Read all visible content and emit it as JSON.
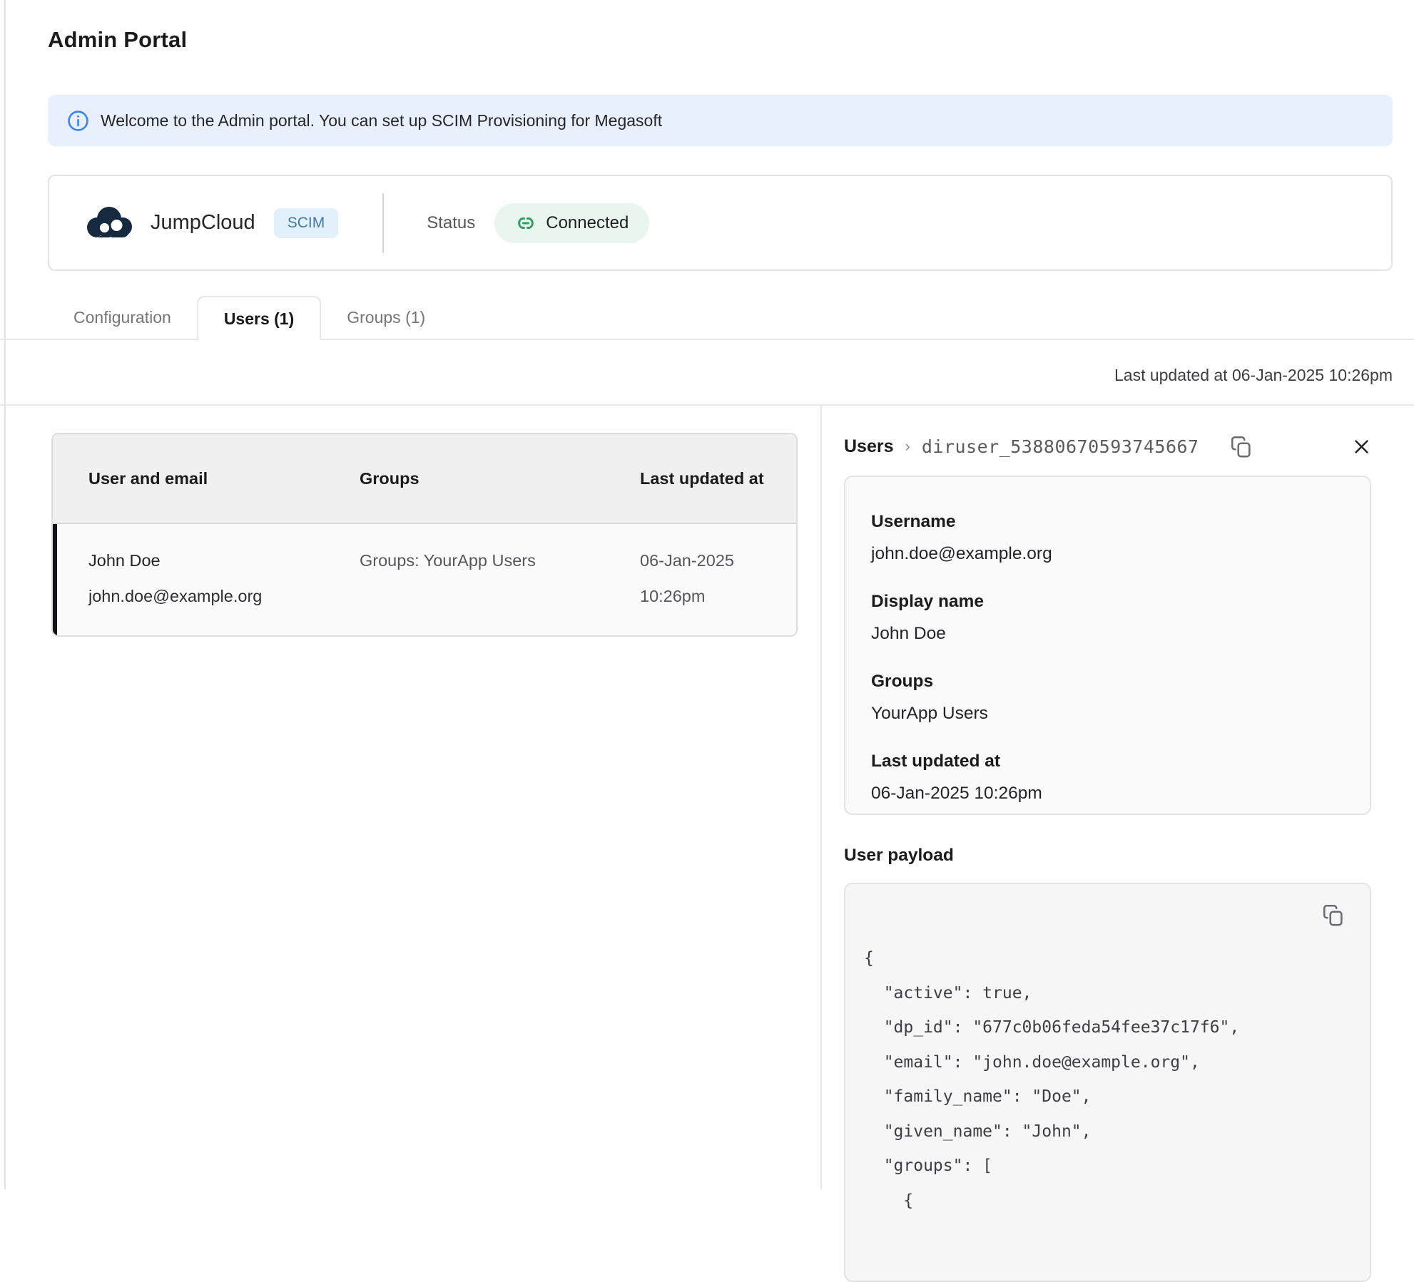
{
  "page": {
    "title": "Admin Portal"
  },
  "banner": {
    "text": "Welcome to the Admin portal. You can set up SCIM Provisioning for Megasoft"
  },
  "provider": {
    "name": "JumpCloud",
    "badge": "SCIM",
    "status_label": "Status",
    "status_value": "Connected"
  },
  "tabs": [
    {
      "label": "Configuration",
      "active": false
    },
    {
      "label": "Users (1)",
      "active": true
    },
    {
      "label": "Groups (1)",
      "active": false
    }
  ],
  "last_updated_line": "Last updated at 06-Jan-2025 10:26pm",
  "table": {
    "headers": [
      "User and email",
      "Groups",
      "Last updated at"
    ],
    "rows": [
      {
        "name": "John Doe",
        "email": "john.doe@example.org",
        "groups": "Groups: YourApp Users",
        "updated_date": "06-Jan-2025",
        "updated_time": "10:26pm"
      }
    ]
  },
  "detail_panel": {
    "breadcrumb": {
      "root": "Users",
      "separator": "›",
      "id": "diruser_53880670593745667"
    },
    "fields": [
      {
        "label": "Username",
        "value": "john.doe@example.org"
      },
      {
        "label": "Display name",
        "value": "John Doe"
      },
      {
        "label": "Groups",
        "value": "YourApp Users"
      },
      {
        "label": "Last updated at",
        "value": "06-Jan-2025 10:26pm"
      }
    ],
    "payload_title": "User payload",
    "payload_lines": [
      "{",
      "  \"active\": true,",
      "  \"dp_id\": \"677c0b06feda54fee37c17f6\",",
      "  \"email\": \"john.doe@example.org\",",
      "  \"family_name\": \"Doe\",",
      "  \"given_name\": \"John\",",
      "  \"groups\": [",
      "    {"
    ]
  },
  "colors": {
    "accent_blue": "#3b82f6",
    "banner_bg": "#e7f0fc",
    "scim_badge_bg": "#e2f0fb",
    "scim_badge_text": "#49799e",
    "connected_green": "#2f9e63",
    "connected_bg": "#e9f6ef",
    "border": "#e4e4e7",
    "logo_navy": "#17293e",
    "selected_row_bar": "#131316"
  }
}
